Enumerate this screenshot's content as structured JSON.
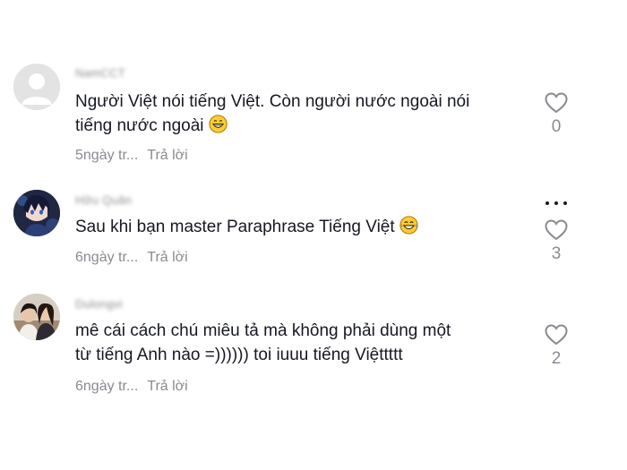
{
  "comments": [
    {
      "username": "NamCCT",
      "text_line1": "Người Việt nói tiếng Việt. Còn người nước ngoài nói",
      "text_line2": "tiếng nước ngoài",
      "emoji": "grinning-face-emoji",
      "time": "5ngày tr...",
      "reply_label": "Trả lời",
      "likes": "0",
      "avatar": "default-avatar-icon"
    },
    {
      "username": "Hữu Quân",
      "text_line1": "Sau khi bạn master Paraphrase Tiếng Việt",
      "emoji": "tears-of-joy-emoji",
      "time": "6ngày tr...",
      "reply_label": "Trả lời",
      "likes": "3",
      "avatar": "anime-avatar"
    },
    {
      "username": "Dulongvi",
      "text_line1": "mê cái cách chú miêu tả mà không phải dùng một",
      "text_line2": "từ tiếng Anh nào =)))))) toi iuuu tiếng Việttttt",
      "time": "6ngày tr...",
      "reply_label": "Trả lời",
      "likes": "2",
      "avatar": "photo-avatar"
    }
  ],
  "more_icon": "more-options-icon",
  "heart_icon": "heart-outline-icon",
  "colors": {
    "text": "#161823",
    "muted": "#8a8b91",
    "background": "#ffffff"
  }
}
